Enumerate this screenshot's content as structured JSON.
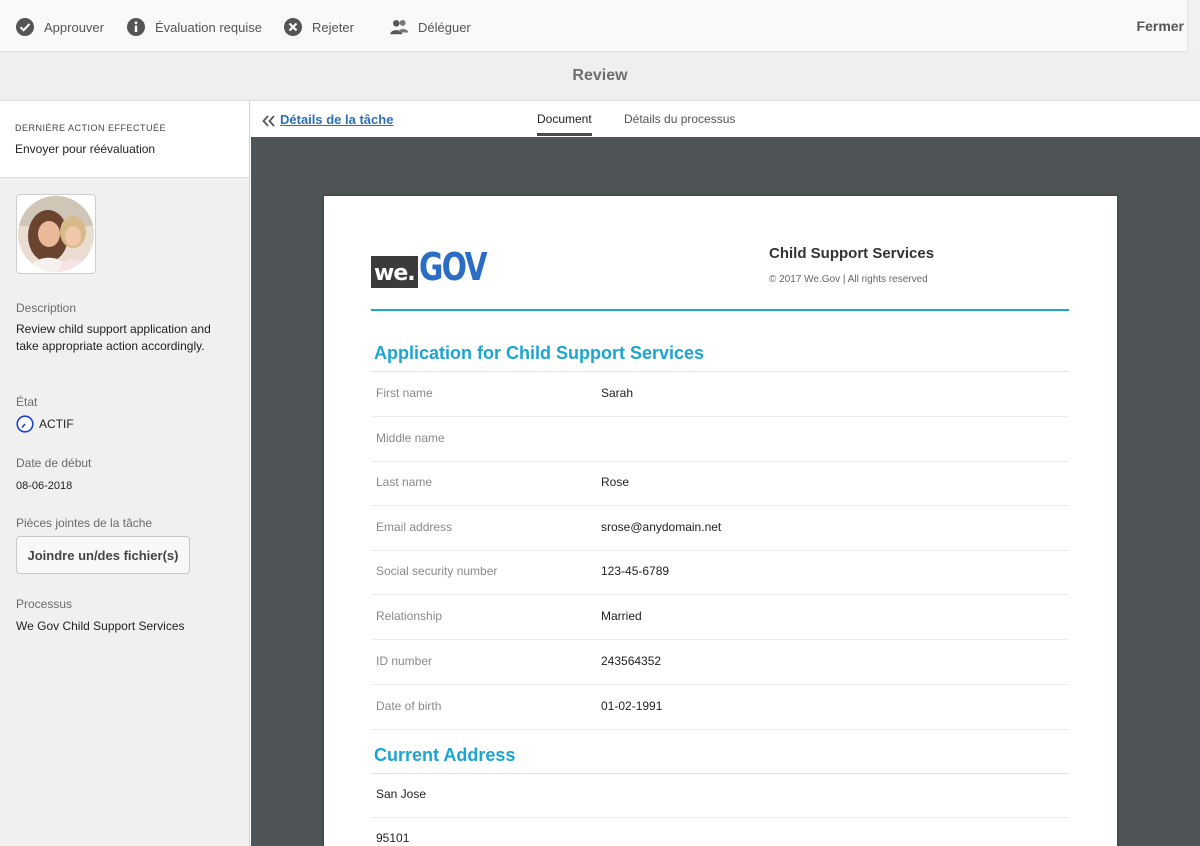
{
  "toolbar": {
    "approve_label": "Approuver",
    "evaluation_label": "Évaluation requise",
    "reject_label": "Rejeter",
    "delegate_label": "Déléguer",
    "close_label": "Fermer"
  },
  "header": {
    "title": "Review"
  },
  "sidebar": {
    "last_action_caption": "DERNIÈRE ACTION EFFECTUÉE",
    "last_action_value": "Envoyer pour réévaluation",
    "description_label": "Description",
    "description_text": "Review child support application and take appropriate action accordingly.",
    "state_label": "État",
    "state_value": "ACTIF",
    "start_date_label": "Date de début",
    "start_date_value": "08-06-2018",
    "attachments_label": "Pièces jointes de la tâche",
    "attach_button_label": "Joindre un/des fichier(s)",
    "process_label": "Processus",
    "process_value": "We Gov Child Support Services"
  },
  "tabs": {
    "back_link": "Détails de la tâche",
    "items": [
      {
        "label": "Document",
        "active": true
      },
      {
        "label": "Détails du processus",
        "active": false
      }
    ]
  },
  "document": {
    "logo_we": "we.",
    "logo_gov": "GOV",
    "org_name": "Child Support Services",
    "copyright": "© 2017 We.Gov | All rights reserved",
    "section1_title": "Application for Child Support Services",
    "fields": [
      {
        "label": "First name",
        "value": "Sarah"
      },
      {
        "label": "Middle name",
        "value": ""
      },
      {
        "label": "Last name",
        "value": "Rose"
      },
      {
        "label": "Email address",
        "value": "srose@anydomain.net"
      },
      {
        "label": "Social security number",
        "value": "123-45-6789"
      },
      {
        "label": "Relationship",
        "value": "Married"
      },
      {
        "label": "ID number",
        "value": "243564352"
      },
      {
        "label": "Date of birth",
        "value": "01-02-1991"
      }
    ],
    "section2_title": "Current Address",
    "address": [
      {
        "value": "San Jose"
      },
      {
        "value": "95101"
      }
    ]
  },
  "colors": {
    "accent_blue": "#1aa5d3",
    "link_blue": "#2d6fb7",
    "logo_blue": "#2b6cc4",
    "viewer_bg": "#4f5457"
  },
  "icons": {
    "approve": "check-circle-icon",
    "evaluation": "info-circle-icon",
    "reject": "x-circle-icon",
    "delegate": "users-icon",
    "state": "clock-icon",
    "back": "double-chevron-left-icon"
  }
}
